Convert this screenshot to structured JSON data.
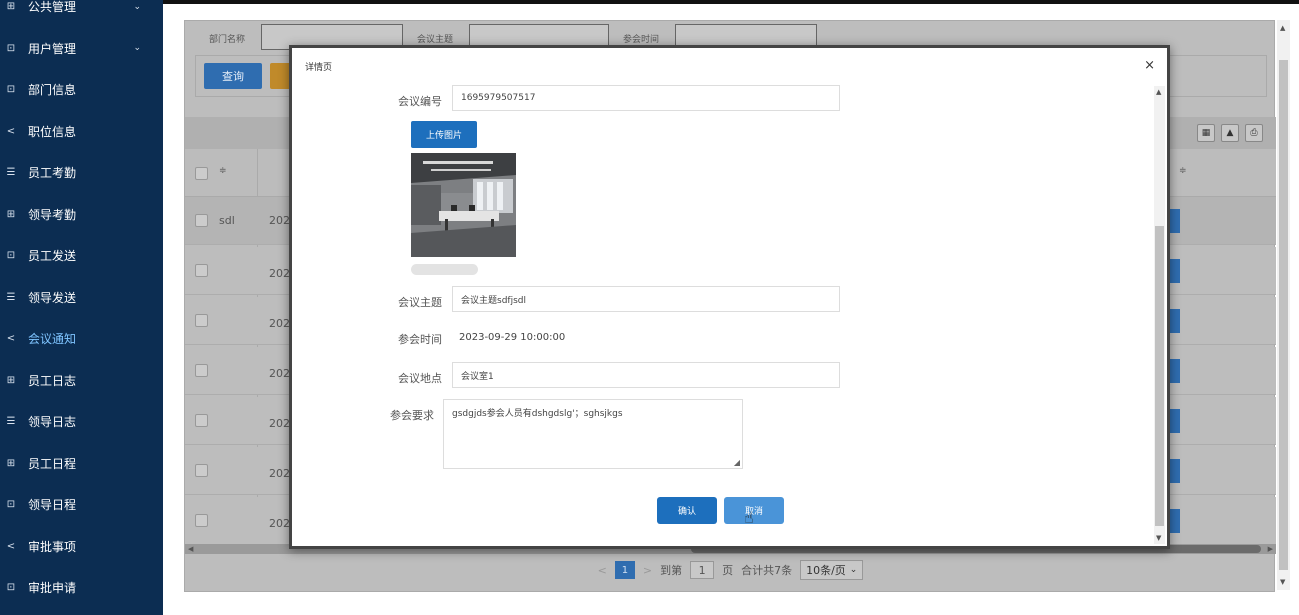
{
  "sidebar": {
    "items": [
      {
        "label": "公共管理",
        "icon": "grid-icon",
        "glyph": "⊞"
      },
      {
        "label": "用户管理",
        "icon": "panel-icon",
        "glyph": "⊡"
      },
      {
        "label": "部门信息",
        "icon": "panel-icon",
        "glyph": "⊡"
      },
      {
        "label": "职位信息",
        "icon": "share-icon",
        "glyph": "<"
      },
      {
        "label": "员工考勤",
        "icon": "list-icon",
        "glyph": "☰"
      },
      {
        "label": "领导考勤",
        "icon": "grid-icon",
        "glyph": "⊞"
      },
      {
        "label": "员工发送",
        "icon": "panel-icon",
        "glyph": "⊡"
      },
      {
        "label": "领导发送",
        "icon": "list-icon",
        "glyph": "☰"
      },
      {
        "label": "会议通知",
        "icon": "share-icon",
        "glyph": "<"
      },
      {
        "label": "员工日志",
        "icon": "grid-icon",
        "glyph": "⊞"
      },
      {
        "label": "领导日志",
        "icon": "list-icon",
        "glyph": "☰"
      },
      {
        "label": "员工日程",
        "icon": "grid-icon",
        "glyph": "⊞"
      },
      {
        "label": "领导日程",
        "icon": "panel-icon",
        "glyph": "⊡"
      },
      {
        "label": "审批事项",
        "icon": "share-icon",
        "glyph": "<"
      },
      {
        "label": "审批申请",
        "icon": "panel-icon",
        "glyph": "⊡"
      }
    ],
    "chevron": "⌄",
    "active_color": "#7fc4ff"
  },
  "filters": {
    "dept_label": "部门名称",
    "topic_label": "会议主题",
    "time_label": "参会时间",
    "query_button": "查询"
  },
  "table": {
    "sort_glyph": "≑",
    "rows": [
      {
        "name": "sdl",
        "date": "2023"
      },
      {
        "name": "",
        "date": "2023"
      },
      {
        "name": "",
        "date": "2023"
      },
      {
        "name": "",
        "date": "2023"
      },
      {
        "name": "",
        "date": "2023"
      },
      {
        "name": "",
        "date": "2023"
      },
      {
        "name": "",
        "date": "2023"
      }
    ]
  },
  "pager": {
    "prev": "<",
    "current": "1",
    "next": ">",
    "goto_label": "到第",
    "goto_value": "1",
    "page_unit": "页",
    "total_label": "合计共7条",
    "page_size": "10条/页",
    "page_size_chevron": "⌄"
  },
  "modal": {
    "title": "详情页",
    "close": "×",
    "meeting_id_label": "会议编号",
    "meeting_id_value": "1695979507517",
    "upload_button": "上传图片",
    "topic_label": "会议主题",
    "topic_value": "会议主题sdfjsdl",
    "time_label": "参会时间",
    "time_value": "2023-09-29 10:00:00",
    "location_label": "会议地点",
    "location_value": "会议室1",
    "requirement_label": "参会要求",
    "requirement_value": "gsdgjds参会人员有dshgdslg'；sghsjkgs",
    "confirm_button": "确认",
    "cancel_button": "取消"
  },
  "colors": {
    "sidebar_bg": "#0c2d52",
    "primary": "#1d6fbd",
    "cancel": "#4a94d8"
  }
}
